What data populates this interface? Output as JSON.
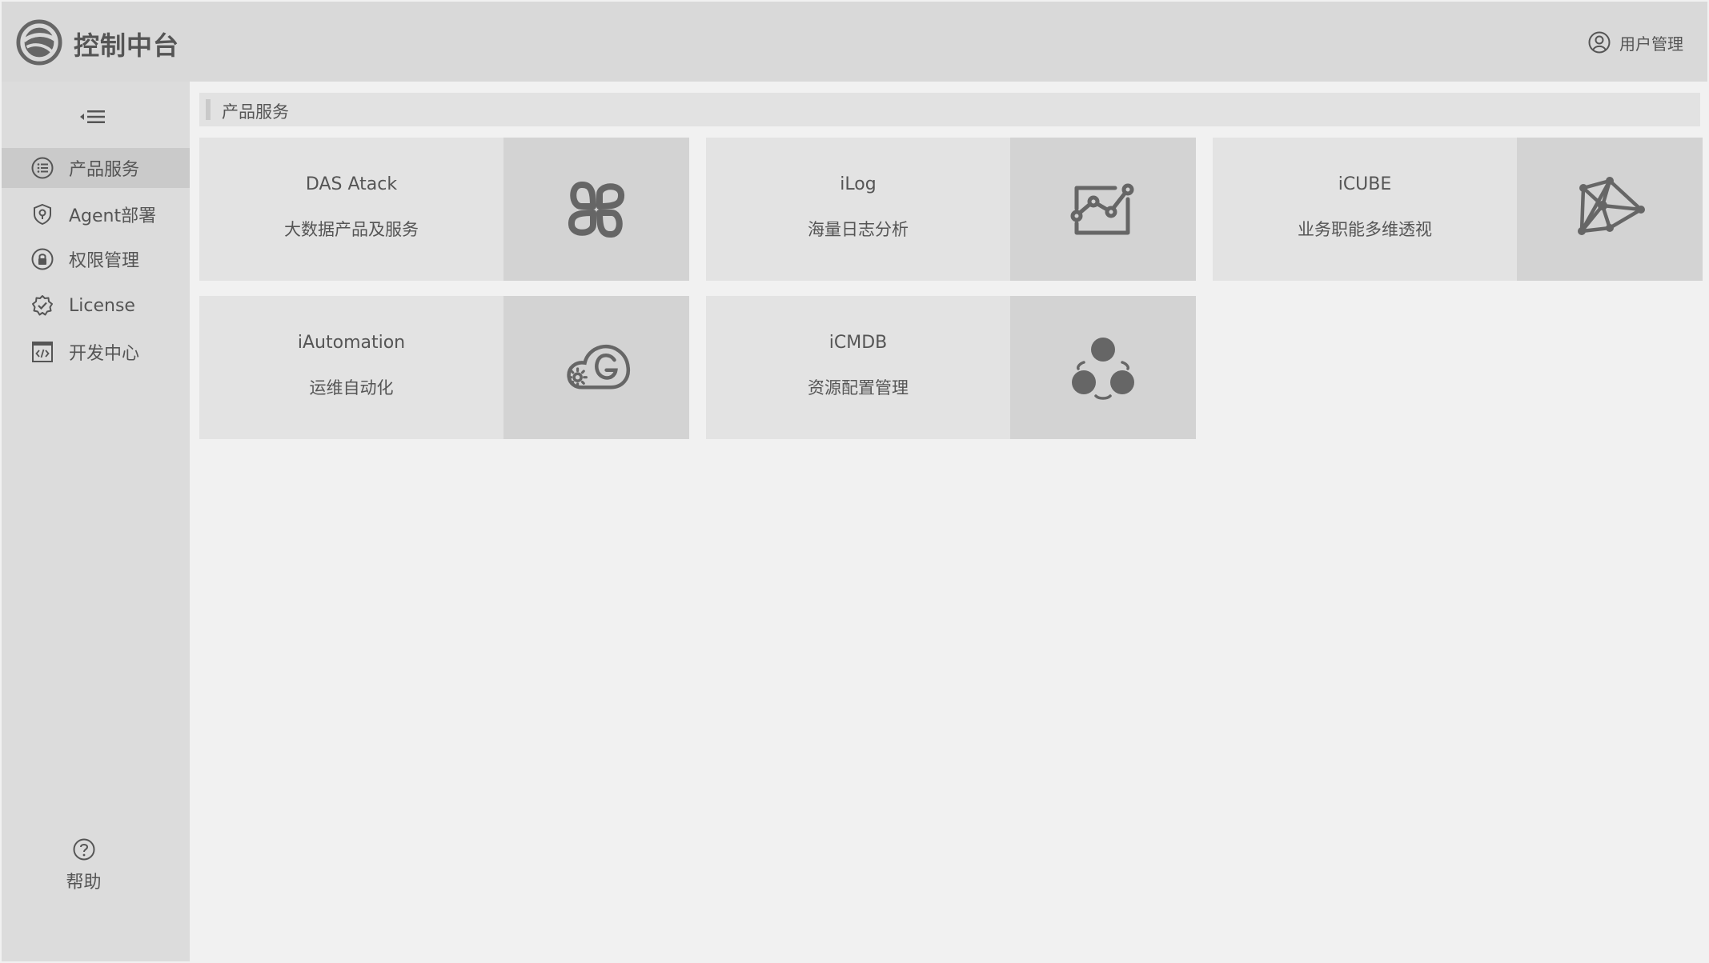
{
  "header": {
    "app_title": "控制中台",
    "logo_icon": "globe-logo-icon",
    "user_menu_label": "用户管理",
    "user_icon": "user-circle-icon"
  },
  "sidebar": {
    "collapse_icon": "collapse-menu-icon",
    "items": [
      {
        "label": "产品服务",
        "icon": "list-circle-icon",
        "active": true
      },
      {
        "label": "Agent部署",
        "icon": "shield-location-icon",
        "active": false
      },
      {
        "label": "权限管理",
        "icon": "lock-circle-icon",
        "active": false
      },
      {
        "label": "License",
        "icon": "badge-check-icon",
        "active": false
      },
      {
        "label": "开发中心",
        "icon": "code-window-icon",
        "active": false
      }
    ],
    "help": {
      "label": "帮助",
      "icon": "question-circle-icon"
    }
  },
  "main": {
    "breadcrumb": "产品服务",
    "cards": [
      {
        "name": "DAS Atack",
        "desc": "大数据产品及服务",
        "icon": "four-petal-icon"
      },
      {
        "name": "iLog",
        "desc": "海量日志分析",
        "icon": "line-chart-frame-icon"
      },
      {
        "name": "iCUBE",
        "desc": "业务职能多维透视",
        "icon": "network-graph-icon"
      },
      {
        "name": "iAutomation",
        "desc": "运维自动化",
        "icon": "cloud-gear-icon"
      },
      {
        "name": "iCMDB",
        "desc": "资源配置管理",
        "icon": "three-circles-cycle-icon"
      }
    ]
  },
  "colors": {
    "header_bg": "#d9d9d9",
    "sidebar_bg": "#dcdcdc",
    "active_item_bg": "#cacaca",
    "card_bg": "#e3e3e3",
    "card_icon_bg": "#d3d3d3",
    "page_bg": "#f1f1f1",
    "icon_color": "#666666"
  }
}
